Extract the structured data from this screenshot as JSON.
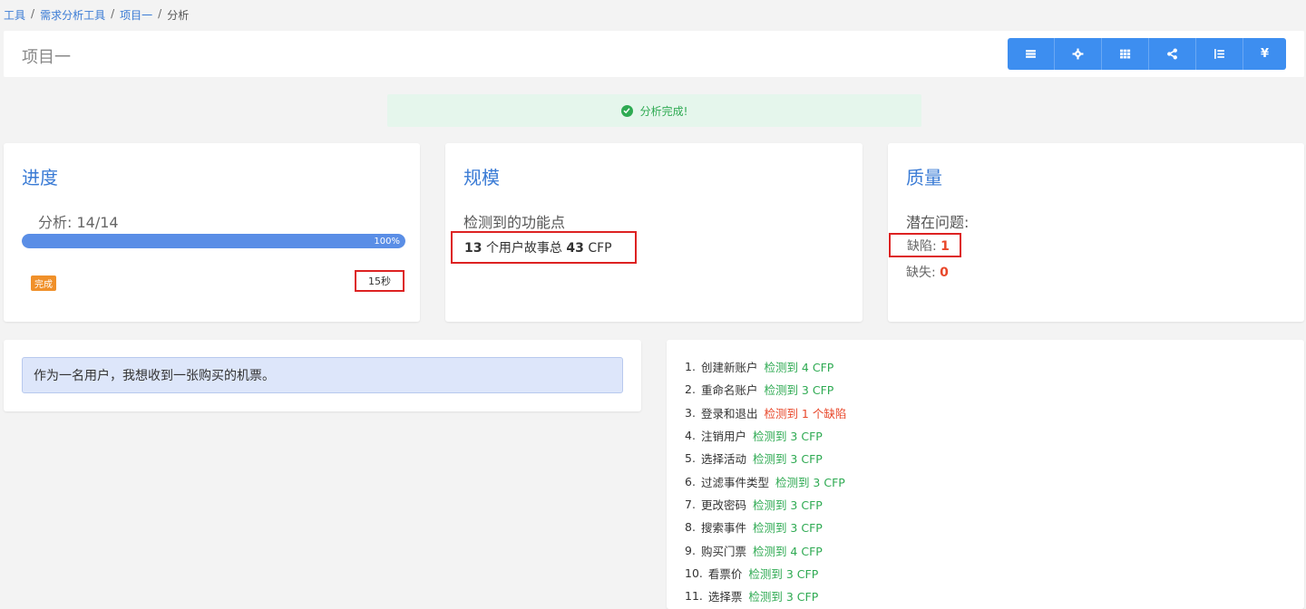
{
  "breadcrumb": {
    "items": [
      "工具",
      "需求分析工具",
      "项目一"
    ],
    "current": "分析",
    "separator": "/"
  },
  "header": {
    "title": "项目一",
    "toolbar": [
      {
        "icon": "list-icon"
      },
      {
        "icon": "gear-icon"
      },
      {
        "icon": "grid-icon"
      },
      {
        "icon": "share-icon"
      },
      {
        "icon": "ordered-list-icon"
      },
      {
        "icon": "yen-icon",
        "glyph": "¥"
      }
    ]
  },
  "alert": {
    "text": "分析完成!"
  },
  "progress": {
    "title": "进度",
    "label": "分析:  14/14",
    "percent": 100,
    "percent_text": "100%",
    "badge": "完成",
    "time": "15秒"
  },
  "scale": {
    "title": "规模",
    "subtitle": "检测到的功能点",
    "stories_count": "13",
    "stories_text": "个用户故事总",
    "cfp_count": "43",
    "cfp_unit": "CFP"
  },
  "quality": {
    "title": "质量",
    "subtitle": "潜在问题:",
    "defect_label": "缺陷:",
    "defect_value": "1",
    "missing_label": "缺失:",
    "missing_value": "0"
  },
  "story": {
    "text": "作为一名用户，我想收到一张购买的机票。"
  },
  "stories": [
    {
      "index": "1.",
      "name": "创建新账户",
      "result": "检测到 4 CFP",
      "status": "ok"
    },
    {
      "index": "2.",
      "name": "重命名账户",
      "result": "检测到 3 CFP",
      "status": "ok"
    },
    {
      "index": "3.",
      "name": "登录和退出",
      "result": "检测到 1 个缺陷",
      "status": "defect"
    },
    {
      "index": "4.",
      "name": "注销用户",
      "result": "检测到 3 CFP",
      "status": "ok"
    },
    {
      "index": "5.",
      "name": "选择活动",
      "result": "检测到 3 CFP",
      "status": "ok"
    },
    {
      "index": "6.",
      "name": "过滤事件类型",
      "result": "检测到 3 CFP",
      "status": "ok"
    },
    {
      "index": "7.",
      "name": "更改密码",
      "result": "检测到 3 CFP",
      "status": "ok"
    },
    {
      "index": "8.",
      "name": "搜索事件",
      "result": "检测到 3 CFP",
      "status": "ok"
    },
    {
      "index": "9.",
      "name": "购买门票",
      "result": "检测到 4 CFP",
      "status": "ok"
    },
    {
      "index": "10.",
      "name": "看票价",
      "result": "检测到 3 CFP",
      "status": "ok"
    },
    {
      "index": "11.",
      "name": "选择票",
      "result": "检测到 3 CFP",
      "status": "ok"
    }
  ],
  "colors": {
    "accent": "#3d8ef0",
    "success": "#2eaa52",
    "danger": "#e8472a",
    "badge": "#f0902a",
    "highlight_border": "#dd2222"
  }
}
